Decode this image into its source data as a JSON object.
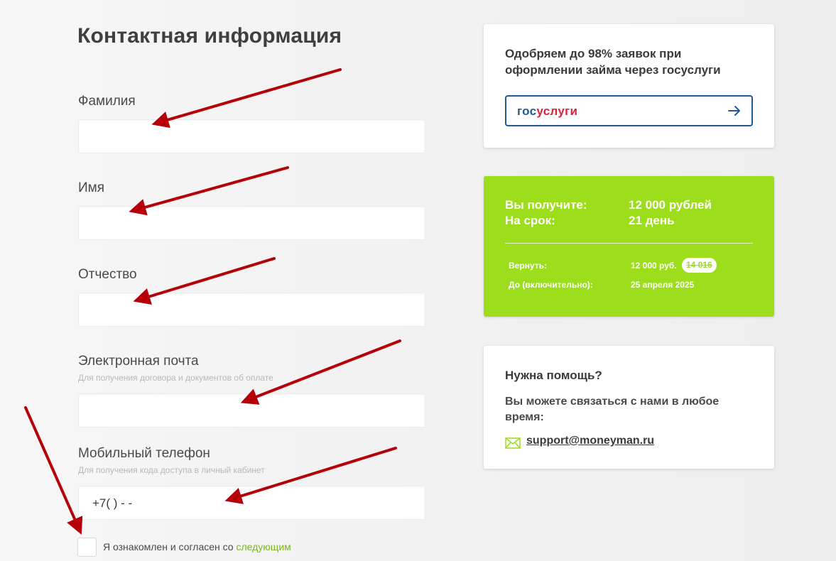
{
  "page_title": "Контактная информация",
  "form": {
    "last_name_label": "Фамилия",
    "first_name_label": "Имя",
    "middle_name_label": "Отчество",
    "email_label": "Электронная почта",
    "email_hint": "Для получения договора и документов об оплате",
    "phone_label": "Мобильный телефон",
    "phone_hint": "Для получения кода доступа в личный кабинет",
    "phone_value": "+7(   )   -  -",
    "agree_text": "Я ознакомлен и согласен со",
    "agree_link": "следующим"
  },
  "gosuslugi_card": {
    "text": "Одобряем до 98% заявок при оформлении займа через госуслуги",
    "logo_part1": "гос",
    "logo_part2": "услуги",
    "arrow_icon": "arrow-right-icon",
    "brand_blue": "#1f5a96",
    "brand_red": "#e0203b"
  },
  "loan_card": {
    "color": "#9cdd1c",
    "receive_label": "Вы получите:",
    "receive_value": "12 000 рублей",
    "term_label": "На срок:",
    "term_value": "21 день",
    "return_label": "Вернуть:",
    "return_value": "12 000 руб.",
    "return_old": "14 016",
    "due_label": "До (включительно):",
    "due_value": "25 апреля 2025"
  },
  "help_card": {
    "title": "Нужна помощь?",
    "text": "Вы можете связаться с нами в любое время:",
    "email": "support@moneyman.ru",
    "mail_icon": "envelope-icon"
  }
}
